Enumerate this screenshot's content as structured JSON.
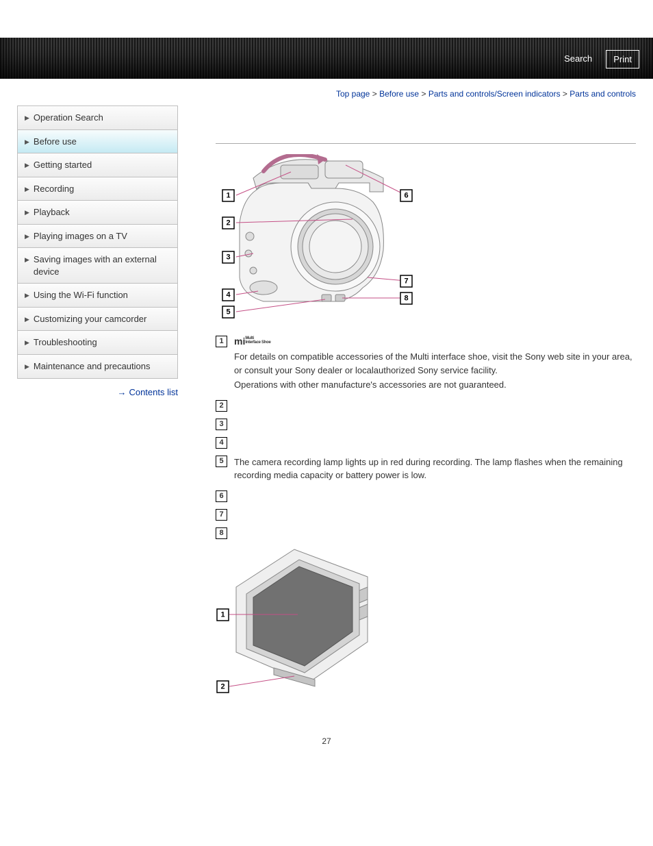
{
  "header": {
    "search": "Search",
    "print": "Print"
  },
  "breadcrumb": {
    "top": "Top page",
    "sep": ">",
    "cat1": "Before use",
    "cat2": "Parts and controls/Screen indicators",
    "current": "Parts and controls"
  },
  "sidebar": {
    "items": [
      "Operation Search",
      "Before use",
      "Getting started",
      "Recording",
      "Playback",
      "Playing images on a TV",
      "Saving images with an external device",
      "Using the Wi-Fi function",
      "Customizing your camcorder",
      "Troubleshooting",
      "Maintenance and precautions"
    ],
    "contents_list": "Contents list"
  },
  "figure1_callouts": [
    "1",
    "2",
    "3",
    "4",
    "5",
    "6",
    "7",
    "8"
  ],
  "figure2_callouts": [
    "1",
    "2"
  ],
  "notes": {
    "item1": {
      "num": "1",
      "logo_main": "mi",
      "logo_sub_top": "Multi",
      "logo_sub_bot": "Interface Shoe",
      "p1": "For details on compatible accessories of the Multi interface shoe, visit the Sony web site in your area, or consult your Sony dealer or localauthorized Sony service facility.",
      "p2": "Operations with other manufacture's accessories are not guaranteed."
    },
    "item2": {
      "num": "2"
    },
    "item3": {
      "num": "3"
    },
    "item4": {
      "num": "4"
    },
    "item5": {
      "num": "5",
      "p1": "The camera recording lamp lights up in red during recording. The lamp flashes when the remaining recording media capacity or battery power is low."
    },
    "item6": {
      "num": "6"
    },
    "item7": {
      "num": "7"
    },
    "item8": {
      "num": "8"
    }
  },
  "page_number": "27"
}
